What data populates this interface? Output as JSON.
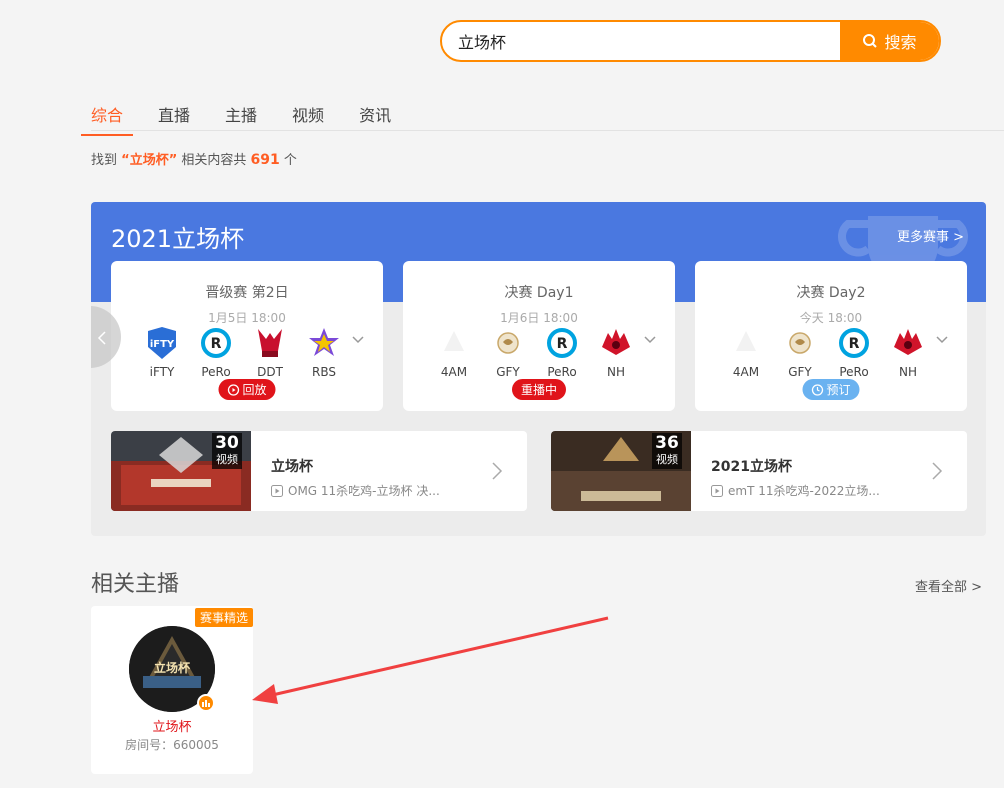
{
  "search": {
    "value": "立场杯",
    "button_label": "搜索"
  },
  "tabs": [
    {
      "label": "综合",
      "active": true
    },
    {
      "label": "直播",
      "active": false
    },
    {
      "label": "主播",
      "active": false
    },
    {
      "label": "视频",
      "active": false
    },
    {
      "label": "资讯",
      "active": false
    }
  ],
  "result": {
    "prefix": "找到",
    "keyword": "“立场杯”",
    "middle": "相关内容共",
    "count": "691",
    "suffix": "个"
  },
  "event": {
    "title": "2021立场杯",
    "more_label": "更多赛事 >",
    "matches": [
      {
        "stage": "晋级赛 第2日",
        "time": "1月5日 18:00",
        "teams": [
          "iFTY",
          "PeRo",
          "DDT",
          "RBS"
        ],
        "badge": "回放",
        "badge_icon": "replay-icon"
      },
      {
        "stage": "决赛 Day1",
        "time": "1月6日 18:00",
        "teams": [
          "4AM",
          "GFY",
          "PeRo",
          "NH"
        ],
        "badge": "重播中",
        "badge_icon": ""
      },
      {
        "stage": "决赛 Day2",
        "time": "今天 18:00",
        "teams": [
          "4AM",
          "GFY",
          "PeRo",
          "NH"
        ],
        "badge": "预订",
        "badge_icon": "clock-icon"
      }
    ],
    "videos": [
      {
        "count": "30",
        "count_label": "视频",
        "title": "立场杯",
        "subtitle": "OMG 11杀吃鸡-立场杯 决..."
      },
      {
        "count": "36",
        "count_label": "视频",
        "title": "2021立场杯",
        "subtitle": "emT 11杀吃鸡-2022立场..."
      }
    ]
  },
  "related": {
    "title": "相关主播",
    "view_all": "查看全部 >",
    "anchor": {
      "badge": "赛事精选",
      "name": "立场杯",
      "room": "房间号：660005",
      "avatar_text": "立场杯"
    }
  },
  "colors": {
    "accent": "#ff8a00",
    "tab_active": "#ff5d23",
    "header_blue": "#4a78e0",
    "live_red": "#e0141a",
    "book_blue": "#6ab2f0"
  }
}
